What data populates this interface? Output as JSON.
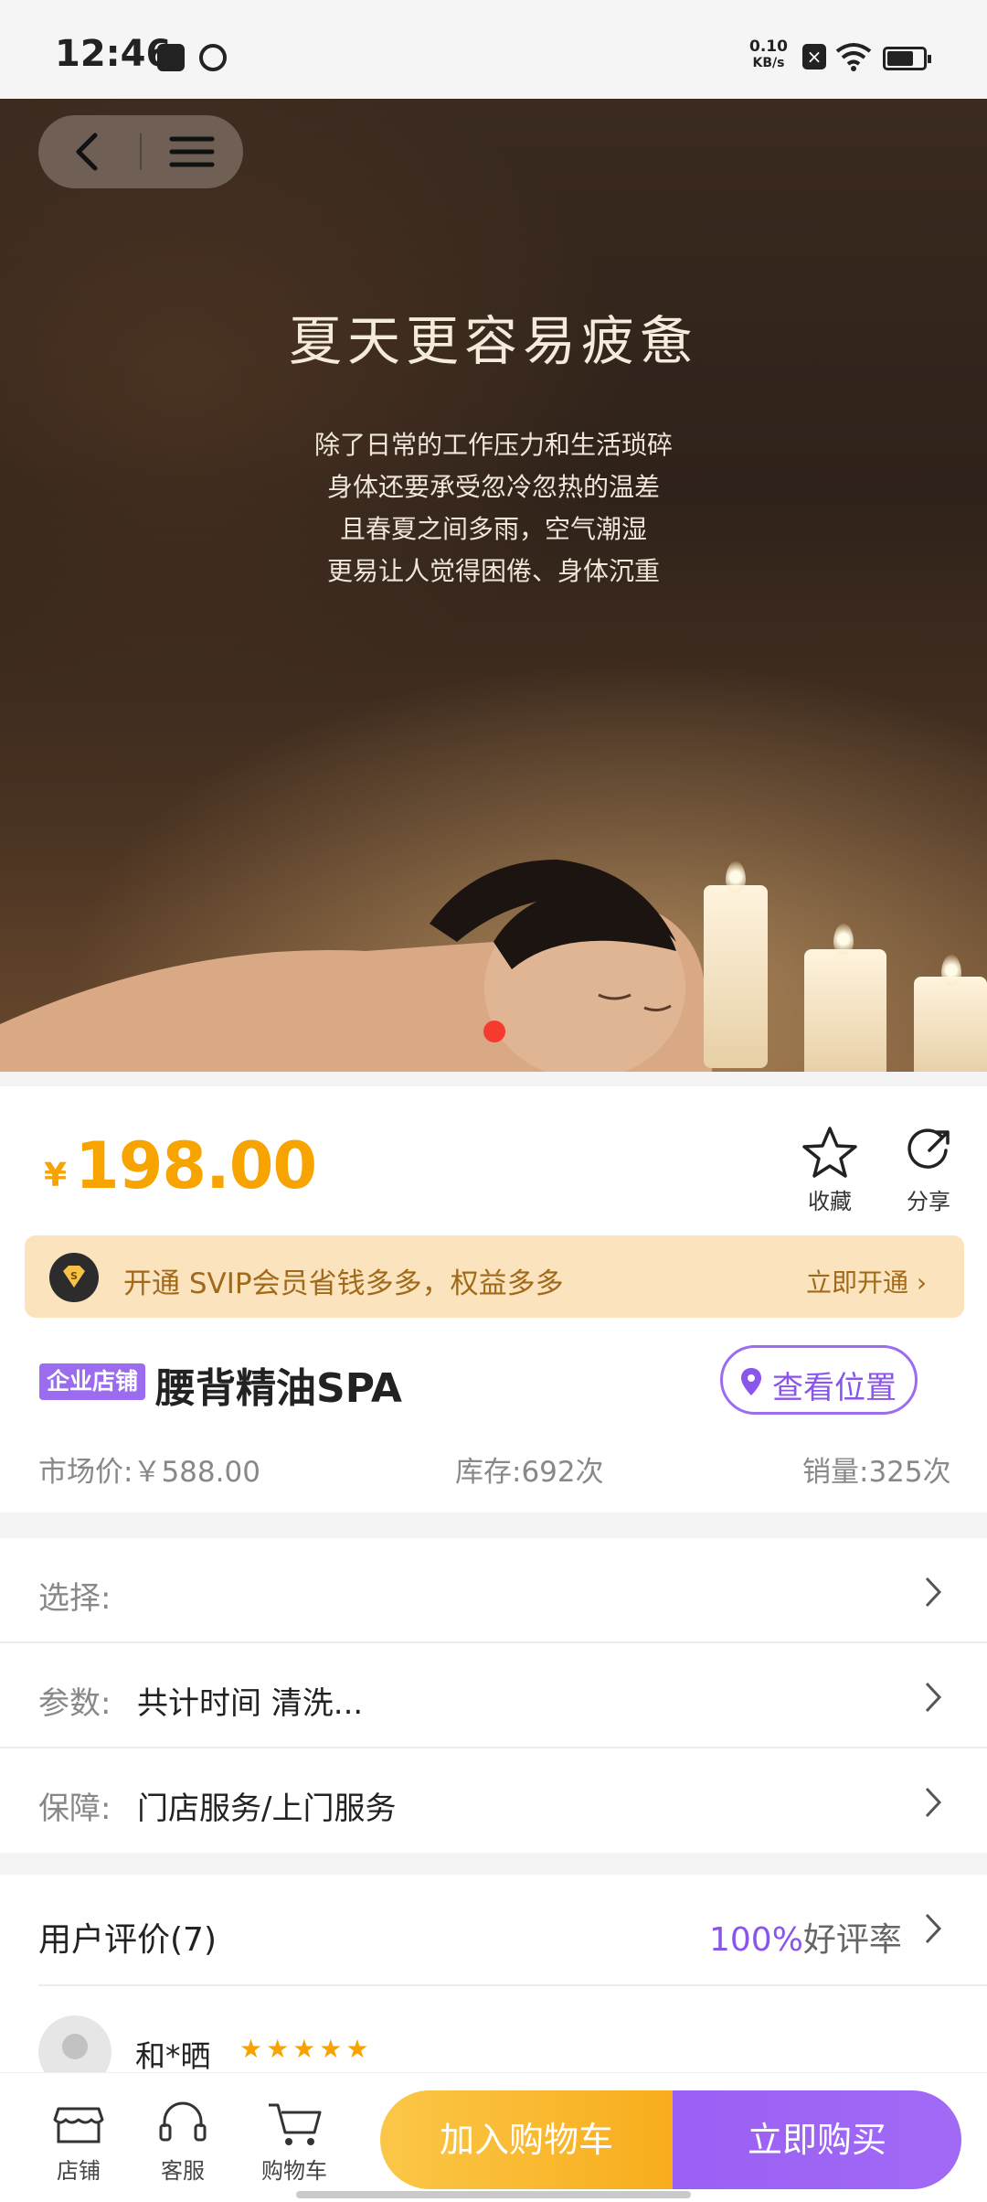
{
  "status_bar": {
    "time": "12:46",
    "net_speed_value": "0.10",
    "net_speed_unit": "KB/s"
  },
  "hero": {
    "title": "夏天更容易疲惫",
    "lines": [
      "除了日常的工作压力和生活琐碎",
      "身体还要承受忽冷忽热的温差",
      "且春夏之间多雨，空气潮湿",
      "更易让人觉得困倦、身体沉重"
    ]
  },
  "price": {
    "symbol": "¥",
    "value": "198.00"
  },
  "actions": {
    "favorite": "收藏",
    "share": "分享"
  },
  "svip": {
    "text": "开通 SVIP会员省钱多多，权益多多",
    "cta": "立即开通 ›"
  },
  "product": {
    "tag": "企业店铺",
    "title": "腰背精油SPA",
    "location_button": "查看位置",
    "market_price": "市场价:￥588.00",
    "stock": "库存:692次",
    "sales": "销量:325次"
  },
  "rows": {
    "select": {
      "label": "选择:",
      "value": ""
    },
    "params": {
      "label": "参数:",
      "value": "共计时间   清洗..."
    },
    "guarantee": {
      "label": "保障:",
      "value": "门店服务/上门服务"
    }
  },
  "reviews": {
    "title": "用户评价(7)",
    "rate_pct": "100%",
    "rate_label": "好评率",
    "first": {
      "name": "和*晒",
      "stars": "★★★★★"
    }
  },
  "bottom": {
    "tab_shop": "店铺",
    "tab_service": "客服",
    "tab_cart": "购物车",
    "add_cart": "加入购物车",
    "buy_now": "立即购买"
  },
  "colors": {
    "price": "#f7a300",
    "accent": "#9b6cf0",
    "svip_bg": "#fae3bd",
    "svip_text": "#a06a1a",
    "dot": "#f53a2f"
  },
  "icons": [
    "back-icon",
    "menu-icon",
    "star-icon",
    "share-icon",
    "svip-diamond-icon",
    "location-pin-icon",
    "chevron-right-icon",
    "shop-icon",
    "headset-icon",
    "cart-icon"
  ]
}
